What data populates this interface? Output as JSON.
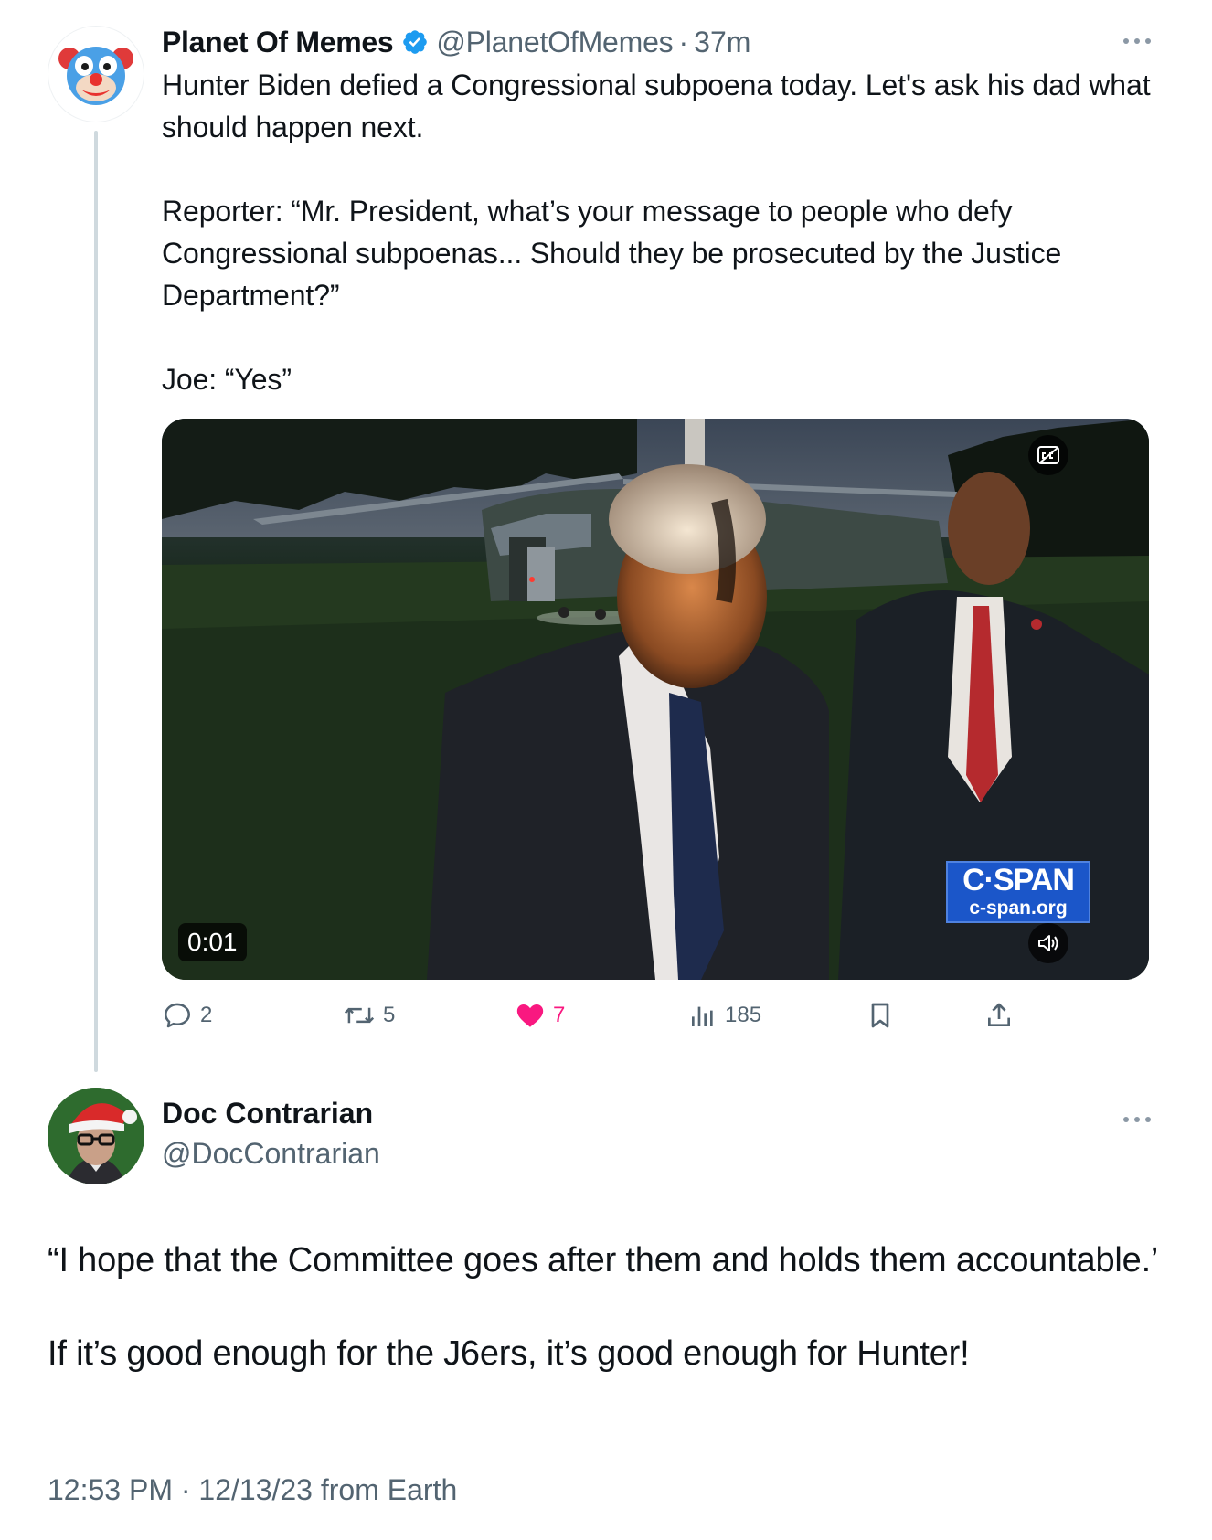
{
  "parent_tweet": {
    "display_name": "Planet Of Memes",
    "handle": "@PlanetOfMemes",
    "separator": "·",
    "time_ago": "37m",
    "avatar_icon": "clown-face-icon",
    "paragraphs": [
      "Hunter Biden defied a Congressional subpoena today. Let's ask his dad what should happen next.",
      "Reporter: “Mr. President, what’s your message to people who defy Congressional subpoenas... Should they be prosecuted by the Justice Department?”",
      "Joe: “Yes”"
    ],
    "video": {
      "timestamp": "0:01",
      "logo_top": "C·SPAN",
      "logo_bottom": "c-span.org"
    },
    "stats": {
      "replies": "2",
      "reposts": "5",
      "likes": "7",
      "views": "185"
    }
  },
  "reply_tweet": {
    "display_name": "Doc Contrarian",
    "handle": "@DocContrarian",
    "paragraphs": [
      "“I hope that the Committee goes after them and holds them accountable.’",
      "If it’s good enough for the J6ers, it’s good enough for Hunter!"
    ],
    "timestamp": "12:53 PM · 12/13/23 from Earth"
  },
  "colors": {
    "text_primary": "#0f1419",
    "text_secondary": "#536471",
    "verified_blue": "#1d9bf0",
    "like_pink": "#f91880",
    "thread_line": "#cfd9de",
    "cspan_blue": "#1b56c9"
  }
}
